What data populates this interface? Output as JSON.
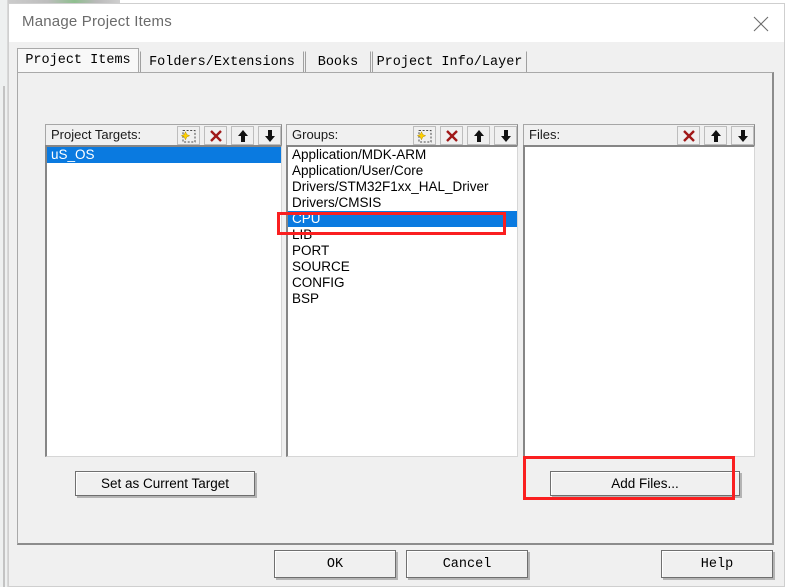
{
  "window": {
    "title": "Manage Project Items",
    "close_icon": "close-x-icon"
  },
  "tabs": [
    {
      "label": "Project Items",
      "selected": true
    },
    {
      "label": "Folders/Extensions",
      "selected": false
    },
    {
      "label": "Books",
      "selected": false
    },
    {
      "label": "Project Info/Layer",
      "selected": false
    }
  ],
  "panels": {
    "project_targets": {
      "label": "Project Targets:",
      "tools": [
        "new-item-icon",
        "delete-x-icon",
        "move-up-icon",
        "move-down-icon"
      ],
      "items": [
        {
          "text": "uS_OS",
          "selected": true
        }
      ]
    },
    "groups": {
      "label": "Groups:",
      "tools": [
        "new-item-icon",
        "delete-x-icon",
        "move-up-icon",
        "move-down-icon"
      ],
      "items": [
        {
          "text": "Application/MDK-ARM",
          "selected": false
        },
        {
          "text": "Application/User/Core",
          "selected": false
        },
        {
          "text": "Drivers/STM32F1xx_HAL_Driver",
          "selected": false
        },
        {
          "text": "Drivers/CMSIS",
          "selected": false
        },
        {
          "text": "CPU",
          "selected": true
        },
        {
          "text": "LIB",
          "selected": false
        },
        {
          "text": "PORT",
          "selected": false
        },
        {
          "text": "SOURCE",
          "selected": false
        },
        {
          "text": "CONFIG",
          "selected": false
        },
        {
          "text": "BSP",
          "selected": false
        }
      ]
    },
    "files": {
      "label": "Files:",
      "tools": [
        "delete-x-icon",
        "move-up-icon",
        "move-down-icon"
      ],
      "items": []
    }
  },
  "buttons": {
    "set_as_current_target": "Set as Current Target",
    "add_files": "Add Files...",
    "ok": "OK",
    "cancel": "Cancel",
    "help": "Help"
  },
  "annotations": {
    "accent_color": "#fa1f20",
    "highlight_color": "#0a7ae0",
    "highlighted": [
      "groups-item-cpu",
      "add-files-button"
    ]
  }
}
